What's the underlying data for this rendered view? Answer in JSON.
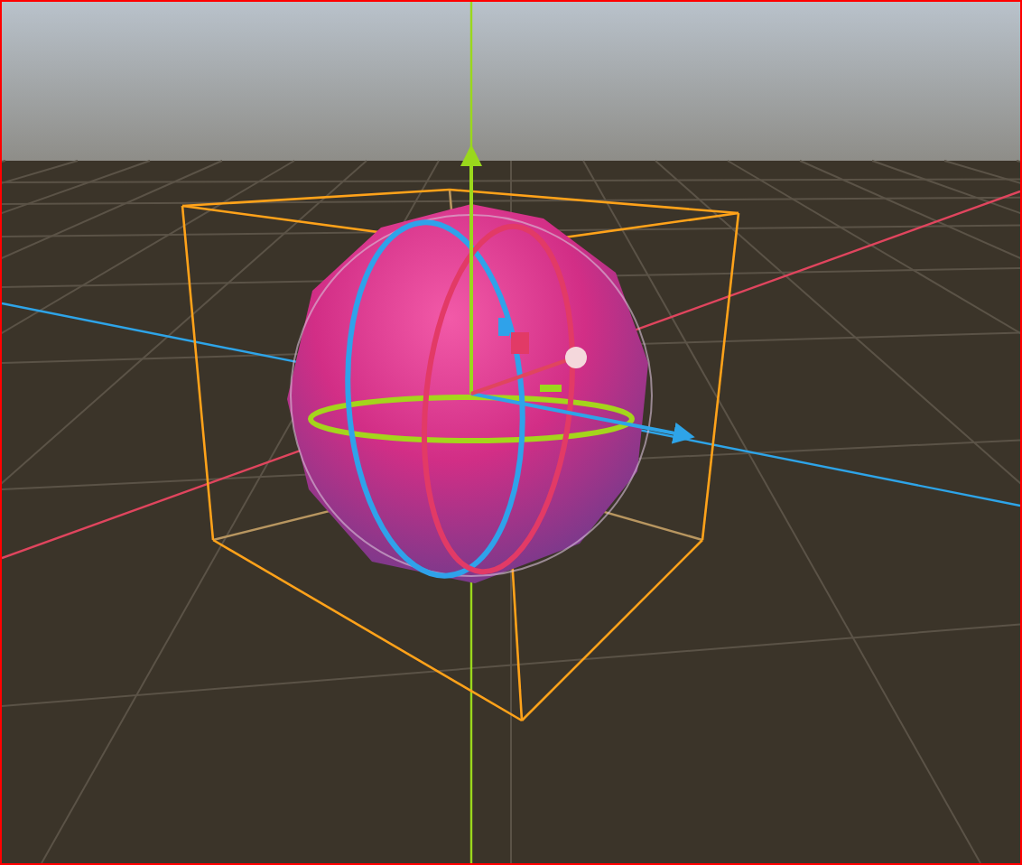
{
  "scene_view": {
    "object": {
      "selected": true
    }
  }
}
